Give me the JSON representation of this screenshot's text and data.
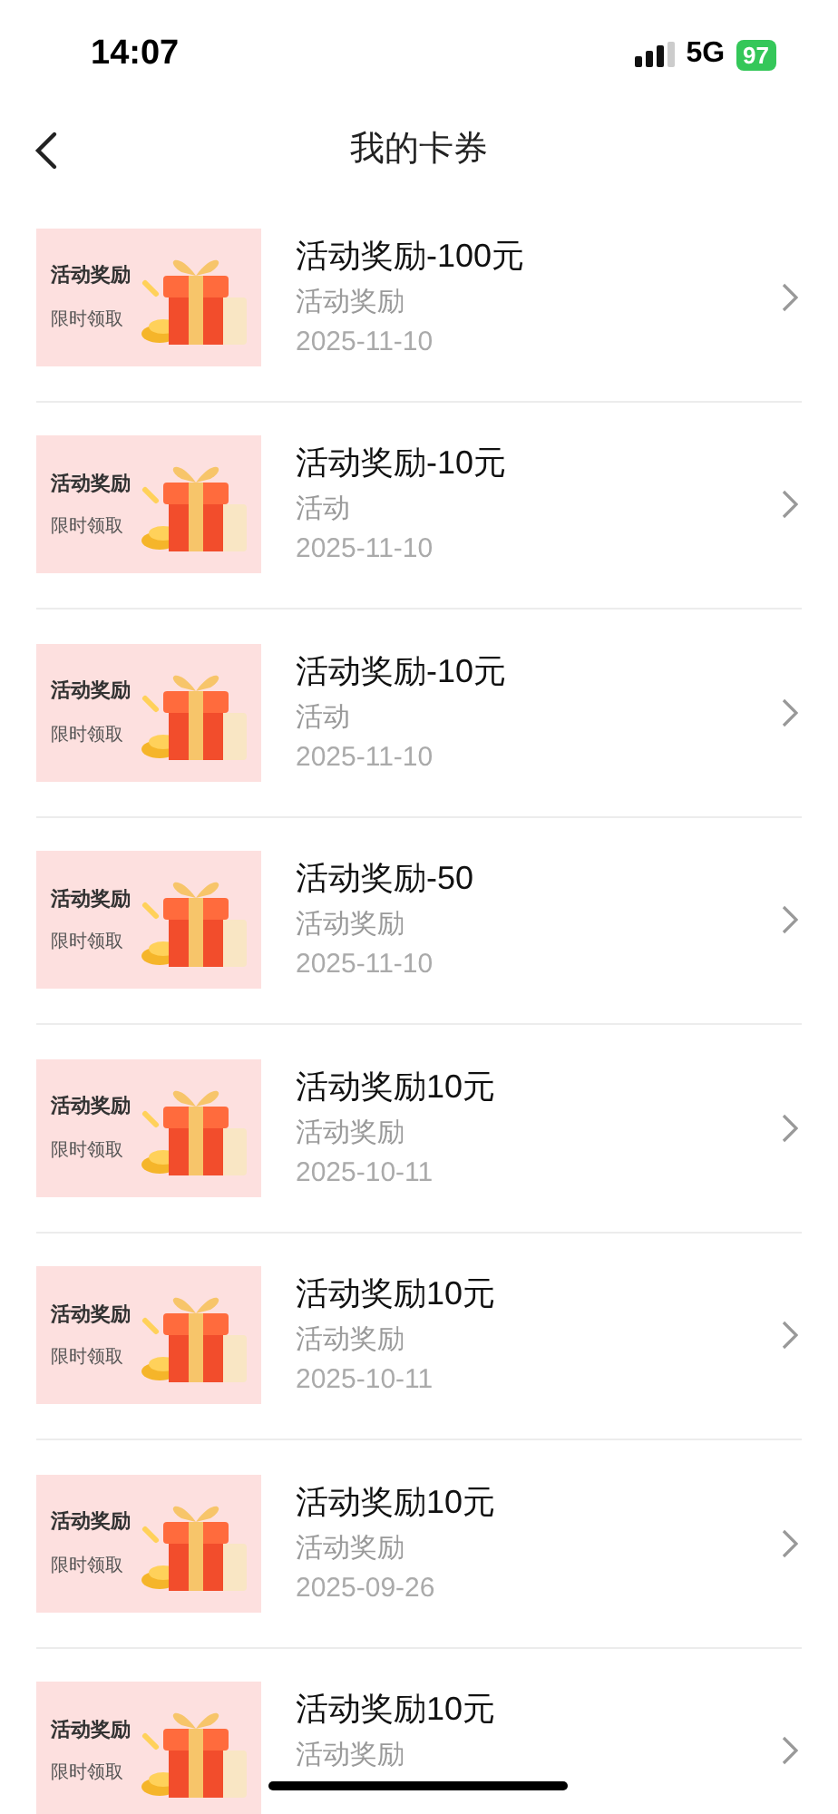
{
  "status_bar": {
    "time": "14:07",
    "network": "5G",
    "battery": "97"
  },
  "nav": {
    "title": "我的卡券"
  },
  "coupons": [
    {
      "badge_title": "活动奖励",
      "badge_subtitle": "限时领取",
      "title": "活动奖励-100元",
      "subtitle": "活动奖励",
      "date": "2025-11-10"
    },
    {
      "badge_title": "活动奖励",
      "badge_subtitle": "限时领取",
      "title": "活动奖励-10元",
      "subtitle": "活动",
      "date": "2025-11-10"
    },
    {
      "badge_title": "活动奖励",
      "badge_subtitle": "限时领取",
      "title": "活动奖励-10元",
      "subtitle": "活动",
      "date": "2025-11-10"
    },
    {
      "badge_title": "活动奖励",
      "badge_subtitle": "限时领取",
      "title": "活动奖励-50",
      "subtitle": "活动奖励",
      "date": "2025-11-10"
    },
    {
      "badge_title": "活动奖励",
      "badge_subtitle": "限时领取",
      "title": "活动奖励10元",
      "subtitle": "活动奖励",
      "date": "2025-10-11"
    },
    {
      "badge_title": "活动奖励",
      "badge_subtitle": "限时领取",
      "title": "活动奖励10元",
      "subtitle": "活动奖励",
      "date": "2025-10-11"
    },
    {
      "badge_title": "活动奖励",
      "badge_subtitle": "限时领取",
      "title": "活动奖励10元",
      "subtitle": "活动奖励",
      "date": "2025-09-26"
    },
    {
      "badge_title": "活动奖励",
      "badge_subtitle": "限时领取",
      "title": "活动奖励10元",
      "subtitle": "活动奖励"
    }
  ]
}
